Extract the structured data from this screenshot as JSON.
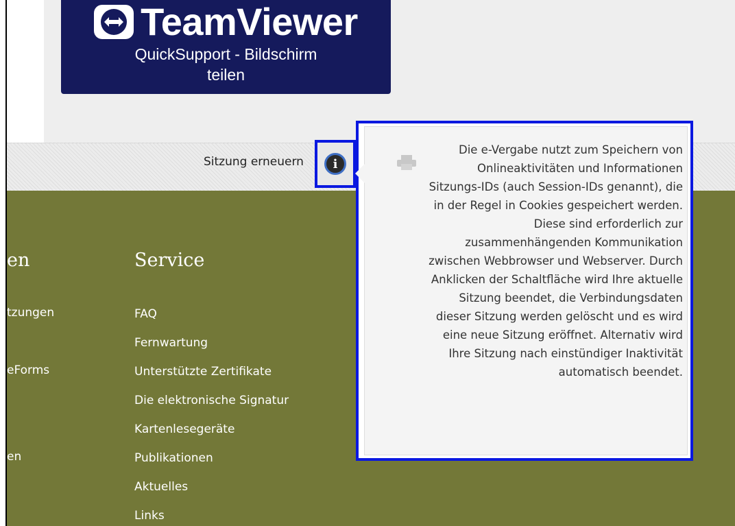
{
  "banner": {
    "brand": "TeamViewer",
    "line1": "QuickSupport - Bildschirm",
    "line2": "teilen",
    "icon": "teamviewer-arrows-icon"
  },
  "session": {
    "label": "Sitzung erneuern",
    "info_icon": "info-icon"
  },
  "tooltip": {
    "lines": [
      "Die e-Vergabe nutzt zum Speichern von",
      "Onlineaktivitäten und Informationen",
      "Sitzungs-IDs (auch Session-IDs genannt), die",
      "in der Regel in Cookies gespeichert werden.",
      "Diese sind erforderlich zur",
      "zusammenhängenden Kommunikation",
      "zwischen Webbrowser und Webserver. Durch",
      "Anklicken der Schaltfläche wird Ihre aktuelle",
      "Sitzung beendet, die Verbindungsdaten",
      "dieser Sitzung werden gelöscht und es wird",
      "eine neue Sitzung eröffnet. Alternativ wird",
      "Ihre Sitzung nach einstündiger Inaktivität",
      "automatisch beendet."
    ]
  },
  "footer": {
    "left_column": {
      "title": "en",
      "items": [
        "tzungen",
        "eForms",
        "en"
      ]
    },
    "service": {
      "title": "Service",
      "items": [
        "FAQ",
        "Fernwartung",
        "Unterstützte Zertifikate",
        "Die elektronische Signatur",
        "Kartenlesegeräte",
        "Publikationen",
        "Aktuelles",
        "Links"
      ]
    }
  },
  "colors": {
    "banner_bg": "#151a5c",
    "footer_bg": "#737838",
    "highlight": "#0a18e0"
  }
}
